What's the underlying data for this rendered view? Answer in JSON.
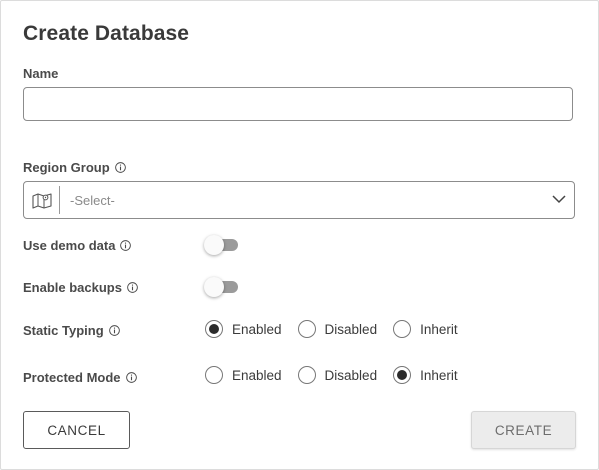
{
  "dialog": {
    "title": "Create Database",
    "name_label": "Name",
    "name_value": "",
    "region_group_label": "Region Group",
    "region_group_select": {
      "icon": "map-icon",
      "selected": "-Select-"
    },
    "use_demo_data": {
      "label": "Use demo data",
      "on": false
    },
    "enable_backups": {
      "label": "Enable backups",
      "on": false
    },
    "static_typing": {
      "label": "Static Typing",
      "options": [
        "Enabled",
        "Disabled",
        "Inherit"
      ],
      "selected": "Enabled"
    },
    "protected_mode": {
      "label": "Protected Mode",
      "options": [
        "Enabled",
        "Disabled",
        "Inherit"
      ],
      "selected": "Inherit"
    },
    "buttons": {
      "cancel": "CANCEL",
      "create": "CREATE"
    }
  }
}
